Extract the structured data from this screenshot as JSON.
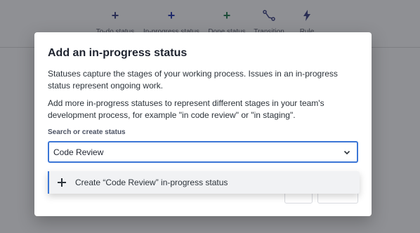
{
  "toolbar": {
    "items": [
      {
        "label": "To-do status",
        "icon": "plus-icon",
        "icon_color": "#2b2f55"
      },
      {
        "label": "In-progress status",
        "icon": "plus-icon",
        "icon_color": "#1f2a6b"
      },
      {
        "label": "Done status",
        "icon": "plus-icon",
        "icon_color": "#1e4d3a"
      },
      {
        "label": "Transition",
        "icon": "transition-icon",
        "icon_color": "#2b2f55"
      },
      {
        "label": "Rule",
        "icon": "lightning-icon",
        "icon_color": "#2b2f55"
      }
    ]
  },
  "modal": {
    "title": "Add an in-progress status",
    "paragraph1": "Statuses capture the stages of your working process. Issues in an in-progress status represent ongoing work.",
    "paragraph2": "Add more in-progress statuses to represent different stages in your team's development process, for example \"in code review\" or \"in staging\".",
    "field_label": "Search or create status",
    "input_value": "Code Review"
  },
  "dropdown": {
    "option_label": "Create “Code Review” in-progress status"
  },
  "colors": {
    "accent": "#3b76d6",
    "overlay": "#8f9094",
    "text": "#2c333a"
  }
}
